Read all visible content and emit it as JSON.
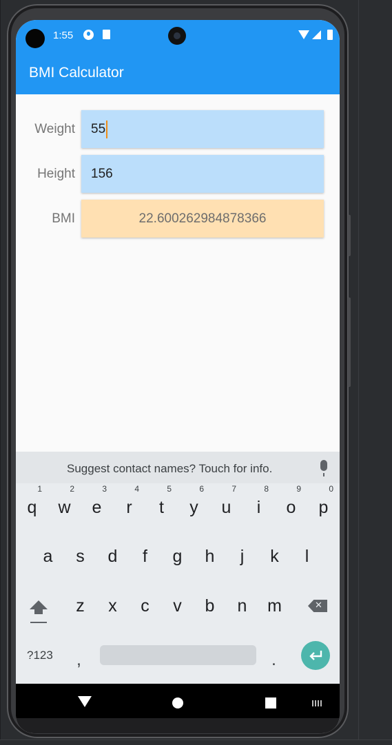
{
  "status_bar": {
    "time": "1:55"
  },
  "app_bar": {
    "title": "BMI Calculator"
  },
  "form": {
    "weight_label": "Weight",
    "weight_value": "55",
    "height_label": "Height",
    "height_value": "156",
    "bmi_label": "BMI",
    "bmi_value": "22.600262984878366"
  },
  "keyboard": {
    "suggestion": "Suggest contact names? Touch for info.",
    "row1": [
      {
        "key": "q",
        "hint": "1"
      },
      {
        "key": "w",
        "hint": "2"
      },
      {
        "key": "e",
        "hint": "3"
      },
      {
        "key": "r",
        "hint": "4"
      },
      {
        "key": "t",
        "hint": "5"
      },
      {
        "key": "y",
        "hint": "6"
      },
      {
        "key": "u",
        "hint": "7"
      },
      {
        "key": "i",
        "hint": "8"
      },
      {
        "key": "o",
        "hint": "9"
      },
      {
        "key": "p",
        "hint": "0"
      }
    ],
    "row2": [
      "a",
      "s",
      "d",
      "f",
      "g",
      "h",
      "j",
      "k",
      "l"
    ],
    "row3": [
      "z",
      "x",
      "c",
      "v",
      "b",
      "n",
      "m"
    ],
    "symbols_label": "?123",
    "comma": ",",
    "period": ".",
    "icons": [
      "shift-icon",
      "backspace-icon",
      "enter-icon",
      "mic-icon"
    ]
  },
  "nav_bar": {
    "icons": [
      "back-icon",
      "home-icon",
      "recents-icon",
      "keyboard-switch-icon"
    ]
  }
}
